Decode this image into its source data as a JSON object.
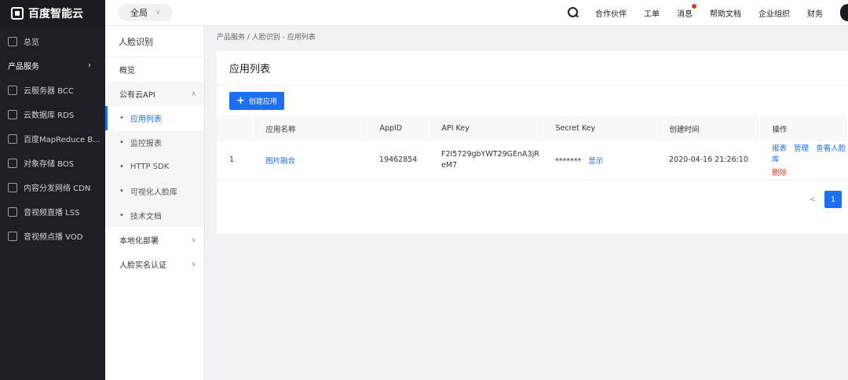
{
  "brand": {
    "name": "百度智能云"
  },
  "sidebar": {
    "overview": "总览",
    "group_label": "产品服务",
    "items": [
      {
        "label": "云服务器 BCC",
        "icon": "server-icon"
      },
      {
        "label": "云数据库 RDS",
        "icon": "database-icon"
      },
      {
        "label": "百度MapReduce B...",
        "icon": "mapreduce-icon"
      },
      {
        "label": "对象存储 BOS",
        "icon": "storage-icon"
      },
      {
        "label": "内容分发网络 CDN",
        "icon": "cdn-icon"
      },
      {
        "label": "音视频直播 LSS",
        "icon": "live-icon"
      },
      {
        "label": "音视频点播 VOD",
        "icon": "vod-icon"
      }
    ]
  },
  "topbar": {
    "scope": "全局",
    "links": [
      "合作伙伴",
      "工单",
      "消息",
      "帮助文档",
      "企业组织",
      "财务"
    ]
  },
  "subnav": {
    "title": "人脸识别",
    "overview": "概览",
    "public_api": "公有云API",
    "children": [
      "应用列表",
      "监控报表",
      "HTTP SDK",
      "可视化人脸库",
      "技术文档"
    ],
    "local_deploy": "本地化部署",
    "realname": "人脸实名认证"
  },
  "breadcrumb": "产品服务 / 人脸识别 - 应用列表",
  "main": {
    "title": "应用列表",
    "create_button": "创建应用",
    "columns": [
      "",
      "应用名称",
      "AppID",
      "API Key",
      "Secret Key",
      "创建时间",
      "操作"
    ],
    "rows": [
      {
        "index": "1",
        "name": "图片融合",
        "app_id": "19462854",
        "api_key_line1": "F2I5729gbYWT29GEnA3jR",
        "api_key_line2": "eM7",
        "secret_mask": "*******",
        "secret_show": "显示",
        "created": "2020-04-16 21:26:10",
        "ops": [
          "报表",
          "管理",
          "查看人脸库",
          "删除"
        ]
      }
    ],
    "pager": {
      "prev": "<",
      "current": "1"
    }
  },
  "colors": {
    "accent": "#1c6ef2",
    "sidebar_bg": "#1d1f25"
  }
}
